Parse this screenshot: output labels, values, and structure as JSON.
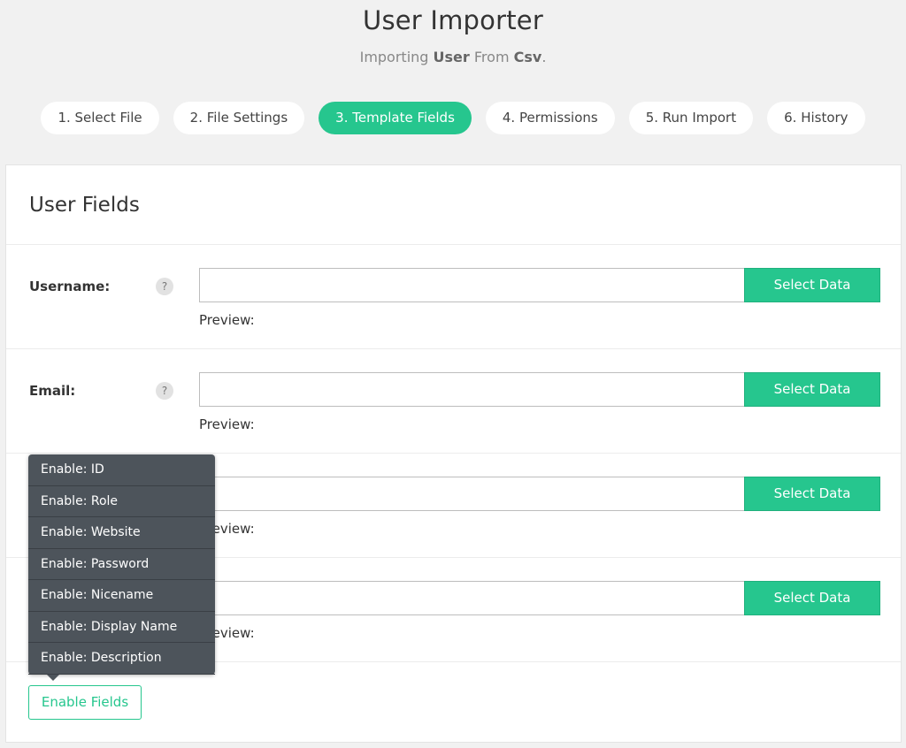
{
  "header": {
    "title": "User Importer",
    "subtitle_prefix": "Importing ",
    "subtitle_entity": "User",
    "subtitle_middle": " From ",
    "subtitle_source": "Csv",
    "subtitle_suffix": "."
  },
  "steps": [
    {
      "label": "1. Select File",
      "active": false
    },
    {
      "label": "2. File Settings",
      "active": false
    },
    {
      "label": "3. Template Fields",
      "active": true
    },
    {
      "label": "4. Permissions",
      "active": false
    },
    {
      "label": "5. Run Import",
      "active": false
    },
    {
      "label": "6. History",
      "active": false
    }
  ],
  "panel": {
    "title": "User Fields",
    "fields": [
      {
        "label": "Username:",
        "help": "?",
        "value": "",
        "button": "Select Data",
        "preview": "Preview:"
      },
      {
        "label": "Email:",
        "help": "?",
        "value": "",
        "button": "Select Data",
        "preview": "Preview:"
      },
      {
        "label": "",
        "help": "",
        "value": "",
        "button": "Select Data",
        "preview": "Preview:"
      },
      {
        "label": "",
        "help": "",
        "value": "",
        "button": "Select Data",
        "preview": "Preview:"
      }
    ],
    "enable_button": "Enable Fields"
  },
  "enable_menu": [
    "Enable: ID",
    "Enable: Role",
    "Enable: Website",
    "Enable: Password",
    "Enable: Nicename",
    "Enable: Display Name",
    "Enable: Description"
  ],
  "colors": {
    "accent": "#26c68e",
    "background": "#f1f1f1",
    "menu": "#4d545b"
  }
}
